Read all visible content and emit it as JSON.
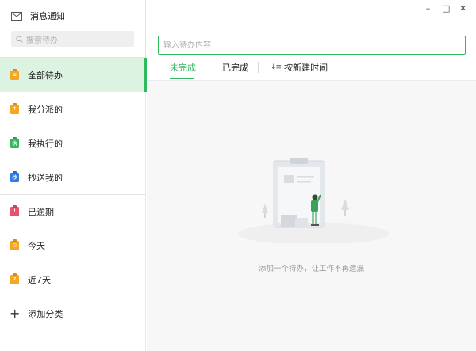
{
  "sidebar": {
    "notify_label": "消息通知",
    "search_placeholder": "搜索待办",
    "items": [
      {
        "label": "全部待办",
        "icon_char": "≡",
        "color": "#f5a623",
        "active": true
      },
      {
        "label": "我分派的",
        "icon_char": "↑",
        "color": "#f5a623"
      },
      {
        "label": "我执行的",
        "icon_char": "执",
        "color": "#2fba5f"
      },
      {
        "label": "抄送我的",
        "icon_char": "抄",
        "color": "#2f7de1"
      },
      {
        "label": "已逾期",
        "icon_char": "!",
        "color": "#e9516b"
      },
      {
        "label": "今天",
        "icon_char": "◷",
        "color": "#f5a623"
      },
      {
        "label": "近7天",
        "icon_char": "7",
        "color": "#f5a623"
      }
    ],
    "add_category_label": "添加分类",
    "add_icon": "+"
  },
  "window_controls": {
    "minimize": "–",
    "maximize": "□",
    "close": "✕"
  },
  "main": {
    "input_placeholder": "输入待办内容",
    "tabs": [
      {
        "label": "未完成",
        "active": true
      },
      {
        "label": "已完成",
        "active": false
      }
    ],
    "sort_icon": "↓≡",
    "sort_label": "按新建时间",
    "empty_text": "添加一个待办，让工作不再遗漏"
  },
  "colors": {
    "accent": "#2fba5f",
    "active_bg": "#dcf3e2"
  }
}
